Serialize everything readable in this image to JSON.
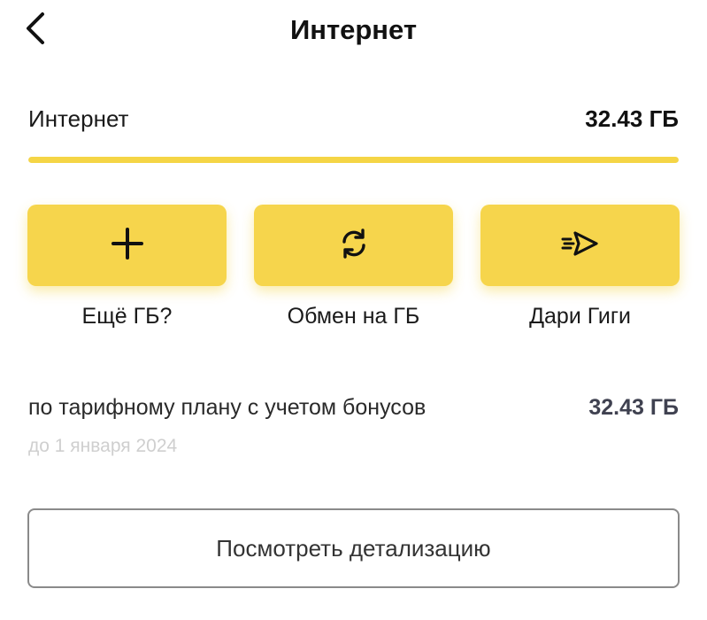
{
  "header": {
    "title": "Интернет",
    "back_icon": "chevron-left-icon"
  },
  "balance": {
    "label": "Интернет",
    "value": "32.43 ГБ",
    "remaining_fraction": 1.0,
    "accent_color": "#f5d546"
  },
  "actions": [
    {
      "label": "Ещё ГБ?",
      "icon": "plus-icon"
    },
    {
      "label": "Обмен на ГБ",
      "icon": "exchange-icon"
    },
    {
      "label": "Дари Гиги",
      "icon": "gift-send-icon"
    }
  ],
  "tariff": {
    "label": "по тарифному плану с учетом бонусов",
    "value": "32.43 ГБ",
    "expiry": "до 1 января 2024"
  },
  "details_button": {
    "label": "Посмотреть детализацию"
  }
}
